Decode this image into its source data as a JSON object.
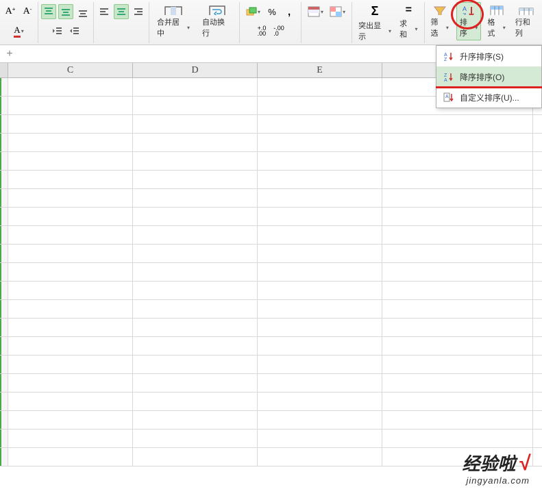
{
  "ribbon": {
    "merge_label": "合并居中",
    "wrap_label": "自动换行",
    "highlight_label": "突出显示",
    "sum_label": "求和",
    "filter_label": "筛选",
    "sort_label": "排序",
    "format_label": "格式",
    "rowcol_label": "行和列",
    "percent": "%",
    "comma": ",",
    "inc_dec": ".0",
    "dec_dec": ".00",
    "inc_dec2": ".00",
    "dec_dec2": ".0",
    "sigma": "Σ",
    "equals": "="
  },
  "menu": {
    "asc": "升序排序(S)",
    "desc": "降序排序(O)",
    "custom": "自定义排序(U)..."
  },
  "columns": {
    "c": "C",
    "d": "D",
    "e": "E",
    "f": ""
  },
  "watermark": {
    "main": "经验啦",
    "check": "√",
    "sub": "jingyanla.com"
  },
  "font_a_plus": "A",
  "font_a_minus": "A"
}
